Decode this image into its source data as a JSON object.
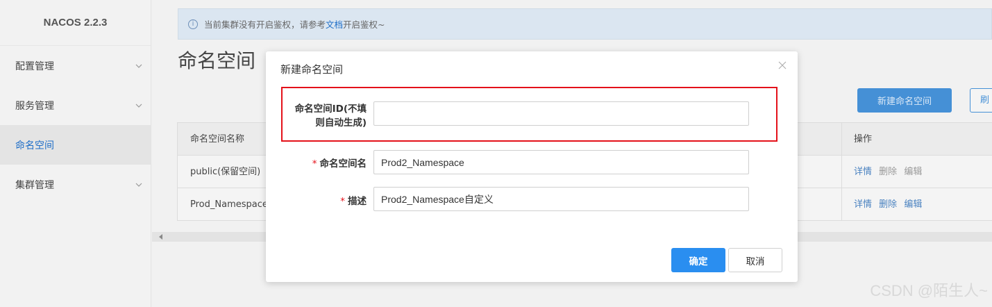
{
  "app": {
    "logo": "NACOS 2.2.3"
  },
  "sidebar": {
    "items": [
      {
        "label": "配置管理",
        "icon": "chevron-down-icon"
      },
      {
        "label": "服务管理",
        "icon": "chevron-down-icon"
      },
      {
        "label": "命名空间",
        "active": true
      },
      {
        "label": "集群管理",
        "icon": "chevron-down-icon"
      }
    ]
  },
  "notice": {
    "prefix": "当前集群没有开启鉴权，请参考",
    "link": "文档",
    "suffix": "开启鉴权~"
  },
  "page": {
    "title": "命名空间",
    "new_button": "新建命名空间",
    "refresh_button": "刷"
  },
  "table": {
    "headers": {
      "name": "命名空间名称",
      "ops": "操作"
    },
    "rows": [
      {
        "name": "public(保留空间)",
        "detail": "详情",
        "delete": "删除",
        "edit": "编辑"
      },
      {
        "name": "Prod_Namespace",
        "detail": "详情",
        "delete": "删除",
        "edit": "编辑"
      }
    ]
  },
  "modal": {
    "title": "新建命名空间",
    "fields": {
      "id_label_line1": "命名空间ID(不填",
      "id_label_line2": "则自动生成)",
      "id_value": "",
      "name_label": "命名空间名",
      "name_value": "Prod2_Namespace",
      "desc_label": "描述",
      "desc_value": "Prod2_Namespace自定义"
    },
    "ok_button": "确定",
    "cancel_button": "取消"
  },
  "watermark": "CSDN @陌生人~",
  "colors": {
    "primary": "#2a8ef0",
    "highlight": "#e4111a",
    "link": "#1d6dc7"
  }
}
